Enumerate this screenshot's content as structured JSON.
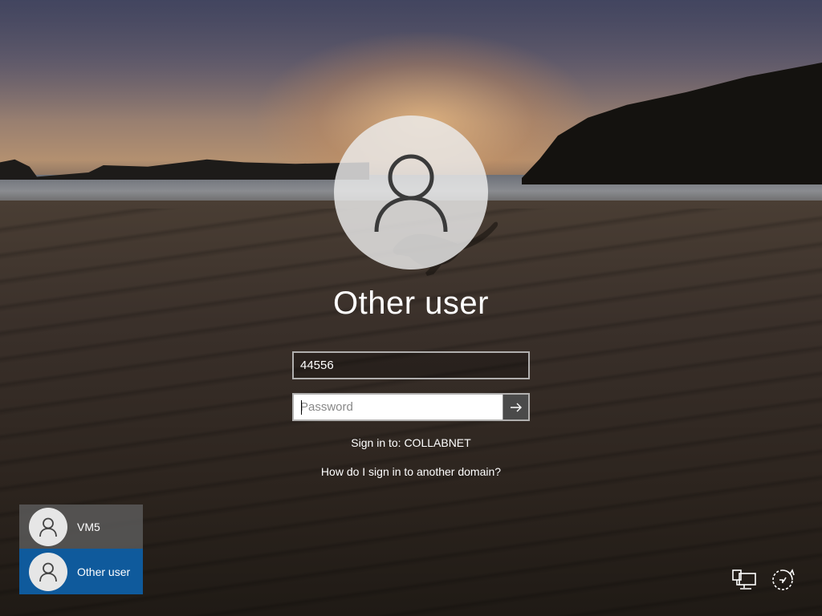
{
  "sign_in": {
    "title": "Other user",
    "username_value": "44556",
    "password_placeholder": "Password",
    "sign_in_to": "Sign in to: COLLABNET",
    "domain_help_link": "How do I sign in to another domain?"
  },
  "user_tiles": [
    {
      "label": "VM5",
      "selected": false
    },
    {
      "label": "Other user",
      "selected": true
    }
  ],
  "icons": {
    "large_avatar": "user-icon",
    "submit": "arrow-right-icon",
    "network": "network-icon",
    "ease_of_access": "ease-of-access-icon"
  },
  "colors": {
    "selected_tile": "#0f5a9c",
    "unselected_tile": "#5f5f5f",
    "submit_button": "#4a4a4a"
  }
}
